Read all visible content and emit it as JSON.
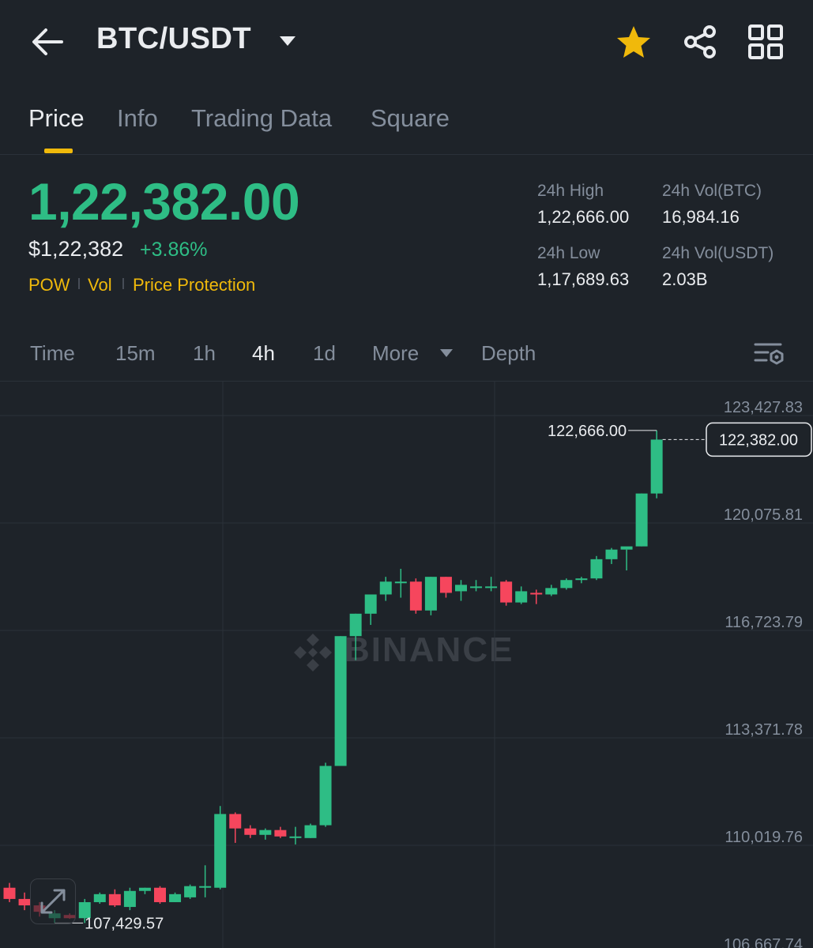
{
  "header": {
    "pair": "BTC/USDT",
    "icons": {
      "back": "back-arrow-icon",
      "caret": "caret-down-icon",
      "favorite": "star-icon",
      "share": "share-icon",
      "menu": "grid-icon"
    },
    "favorite_color": "#f0b90b"
  },
  "tabs": [
    {
      "label": "Price",
      "active": true
    },
    {
      "label": "Info",
      "active": false
    },
    {
      "label": "Trading Data",
      "active": false
    },
    {
      "label": "Square",
      "active": false
    }
  ],
  "ticker": {
    "last_price": "1,22,382.00",
    "usd_value": "$1,22,382",
    "change": "+3.86%",
    "tags": [
      "POW",
      "Vol",
      "Price Protection"
    ],
    "stats": {
      "high_label": "24h High",
      "high_value": "1,22,666.00",
      "vol_btc_label": "24h Vol(BTC)",
      "vol_btc_value": "16,984.16",
      "low_label": "24h Low",
      "low_value": "1,17,689.63",
      "vol_usdt_label": "24h Vol(USDT)",
      "vol_usdt_value": "2.03B"
    }
  },
  "intervals": [
    {
      "label": "Time",
      "active": false
    },
    {
      "label": "15m",
      "active": false
    },
    {
      "label": "1h",
      "active": false
    },
    {
      "label": "4h",
      "active": true
    },
    {
      "label": "1d",
      "active": false
    },
    {
      "label": "More",
      "active": false
    },
    {
      "label": "Depth",
      "active": false
    }
  ],
  "colors": {
    "up": "#2ebd85",
    "down": "#f6465d",
    "accent": "#f0b90b",
    "background": "#1e2329"
  },
  "watermark": "BINANCE",
  "chart_data": {
    "type": "candlestick",
    "y_ticks": [
      "123,427.83",
      "120,075.81",
      "116,723.79",
      "113,371.78",
      "110,019.76",
      "106,667.74"
    ],
    "ylim": [
      106667.74,
      123427.83
    ],
    "high_marker": "122,666.00",
    "low_marker": "107,429.57",
    "last_price_label": "122,382.00",
    "last_price": 122382,
    "candles": [
      {
        "o": 108400,
        "h": 108550,
        "c": 108050,
        "l": 107950
      },
      {
        "o": 108050,
        "h": 108250,
        "c": 107850,
        "l": 107700
      },
      {
        "o": 107850,
        "h": 107950,
        "c": 107650,
        "l": 107500
      },
      {
        "o": 107450,
        "h": 107700,
        "c": 107600,
        "l": 107300
      },
      {
        "o": 107550,
        "h": 107600,
        "c": 107450,
        "l": 107429.57
      },
      {
        "o": 107450,
        "h": 108050,
        "c": 107950,
        "l": 107300
      },
      {
        "o": 107950,
        "h": 108250,
        "c": 108200,
        "l": 107900
      },
      {
        "o": 108200,
        "h": 108350,
        "c": 107850,
        "l": 107800
      },
      {
        "o": 107800,
        "h": 108400,
        "c": 108300,
        "l": 107700
      },
      {
        "o": 108300,
        "h": 108400,
        "c": 108400,
        "l": 108200
      },
      {
        "o": 108400,
        "h": 108450,
        "c": 107950,
        "l": 107900
      },
      {
        "o": 107950,
        "h": 108250,
        "c": 108200,
        "l": 107950
      },
      {
        "o": 108100,
        "h": 108500,
        "c": 108450,
        "l": 108050
      },
      {
        "o": 108450,
        "h": 109100,
        "c": 108450,
        "l": 108100
      },
      {
        "o": 108400,
        "h": 110950,
        "c": 110700,
        "l": 108350
      },
      {
        "o": 110700,
        "h": 110750,
        "c": 110250,
        "l": 109800
      },
      {
        "o": 110250,
        "h": 110350,
        "c": 110050,
        "l": 109950
      },
      {
        "o": 110050,
        "h": 110250,
        "c": 110200,
        "l": 109900
      },
      {
        "o": 110200,
        "h": 110300,
        "c": 110000,
        "l": 109950
      },
      {
        "o": 110000,
        "h": 110300,
        "c": 110000,
        "l": 109750
      },
      {
        "o": 109950,
        "h": 110400,
        "c": 110350,
        "l": 109950
      },
      {
        "o": 110350,
        "h": 112300,
        "c": 112200,
        "l": 110300
      },
      {
        "o": 112200,
        "h": 116250,
        "c": 116250,
        "l": 112200
      },
      {
        "o": 116250,
        "h": 116950,
        "c": 116950,
        "l": 115500
      },
      {
        "o": 116950,
        "h": 117500,
        "c": 117550,
        "l": 116600
      },
      {
        "o": 117550,
        "h": 118100,
        "c": 117950,
        "l": 117350
      },
      {
        "o": 117950,
        "h": 118350,
        "c": 117950,
        "l": 117450
      },
      {
        "o": 117950,
        "h": 118050,
        "c": 117050,
        "l": 116950
      },
      {
        "o": 117050,
        "h": 118100,
        "c": 118100,
        "l": 116900
      },
      {
        "o": 118100,
        "h": 118100,
        "c": 117600,
        "l": 117450
      },
      {
        "o": 117650,
        "h": 118000,
        "c": 117850,
        "l": 117350
      },
      {
        "o": 117800,
        "h": 118000,
        "c": 117800,
        "l": 117650
      },
      {
        "o": 117800,
        "h": 118100,
        "c": 117800,
        "l": 117650
      },
      {
        "o": 117950,
        "h": 118000,
        "c": 117300,
        "l": 117200
      },
      {
        "o": 117300,
        "h": 117800,
        "c": 117650,
        "l": 117250
      },
      {
        "o": 117600,
        "h": 117700,
        "c": 117550,
        "l": 117250
      },
      {
        "o": 117550,
        "h": 117850,
        "c": 117750,
        "l": 117500
      },
      {
        "o": 117750,
        "h": 118050,
        "c": 118000,
        "l": 117700
      },
      {
        "o": 118000,
        "h": 118100,
        "c": 118050,
        "l": 117900
      },
      {
        "o": 118050,
        "h": 118750,
        "c": 118650,
        "l": 118000
      },
      {
        "o": 118650,
        "h": 119000,
        "c": 118950,
        "l": 118500
      },
      {
        "o": 118950,
        "h": 118950,
        "c": 119050,
        "l": 118300
      },
      {
        "o": 119050,
        "h": 120700,
        "c": 120700,
        "l": 119050
      },
      {
        "o": 120700,
        "h": 122666,
        "c": 122382,
        "l": 120550
      }
    ]
  }
}
